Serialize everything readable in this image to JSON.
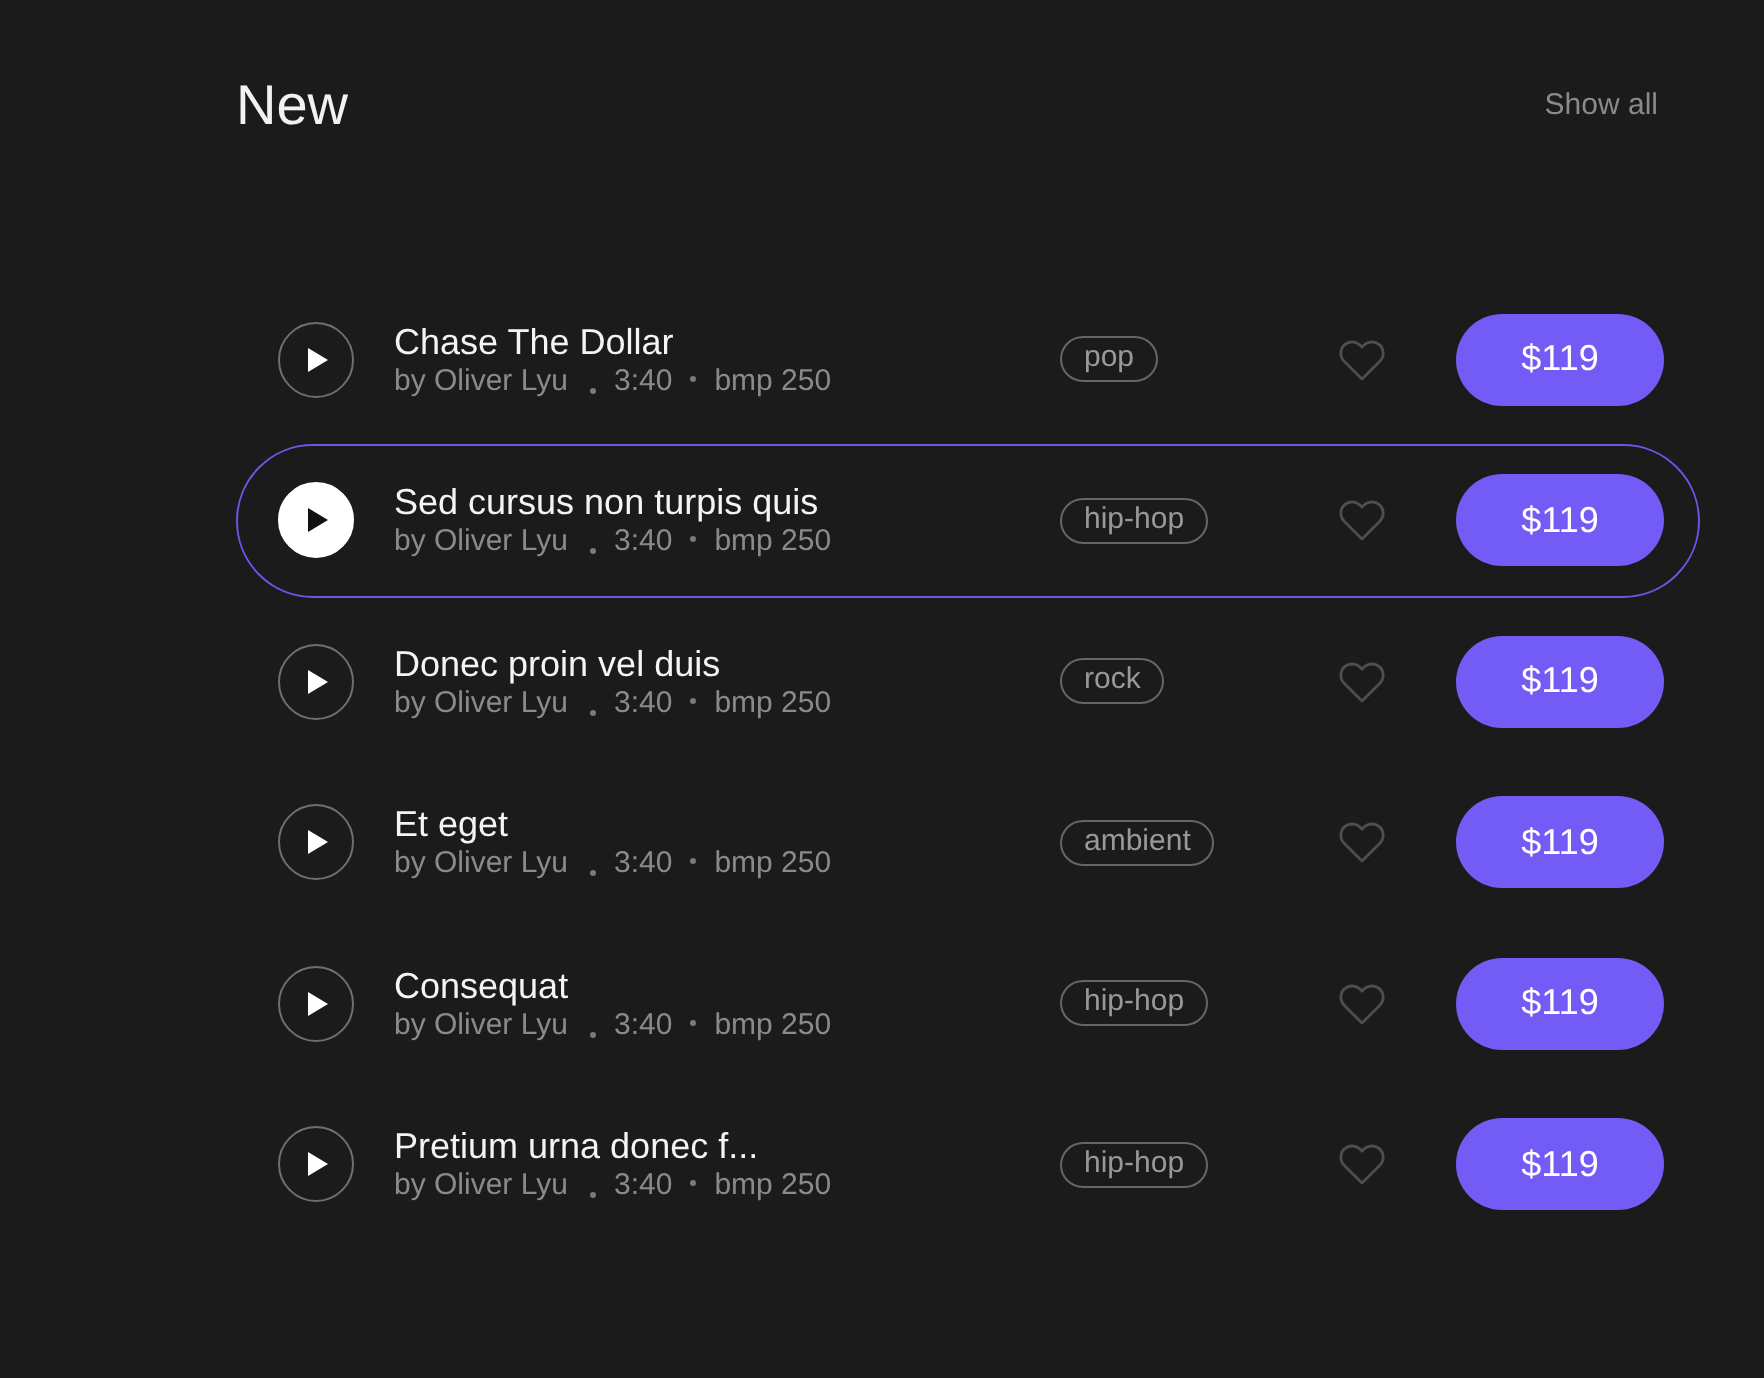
{
  "section": {
    "title": "New",
    "link": "Show all"
  },
  "tracks": [
    {
      "title": "Chase The Dollar",
      "artist": "by Oliver Lyu",
      "duration": "3:40",
      "bpm": "bmp 250",
      "genre": "pop",
      "price": "$119",
      "selected": false
    },
    {
      "title": "Sed cursus non turpis quis",
      "artist": "by Oliver Lyu",
      "duration": "3:40",
      "bpm": "bmp 250",
      "genre": "hip-hop",
      "price": "$119",
      "selected": true
    },
    {
      "title": "Donec proin vel duis",
      "artist": "by Oliver Lyu",
      "duration": "3:40",
      "bpm": "bmp 250",
      "genre": "rock",
      "price": "$119",
      "selected": false
    },
    {
      "title": "Et eget",
      "artist": "by Oliver Lyu",
      "duration": "3:40",
      "bpm": "bmp 250",
      "genre": "ambient",
      "price": "$119",
      "selected": false
    },
    {
      "title": "Consequat",
      "artist": "by Oliver Lyu",
      "duration": "3:40",
      "bpm": "bmp 250",
      "genre": "hip-hop",
      "price": "$119",
      "selected": false
    },
    {
      "title": "Pretium urna donec f...",
      "artist": "by Oliver Lyu",
      "duration": "3:40",
      "bpm": "bmp 250",
      "genre": "hip-hop",
      "price": "$119",
      "selected": false
    }
  ]
}
